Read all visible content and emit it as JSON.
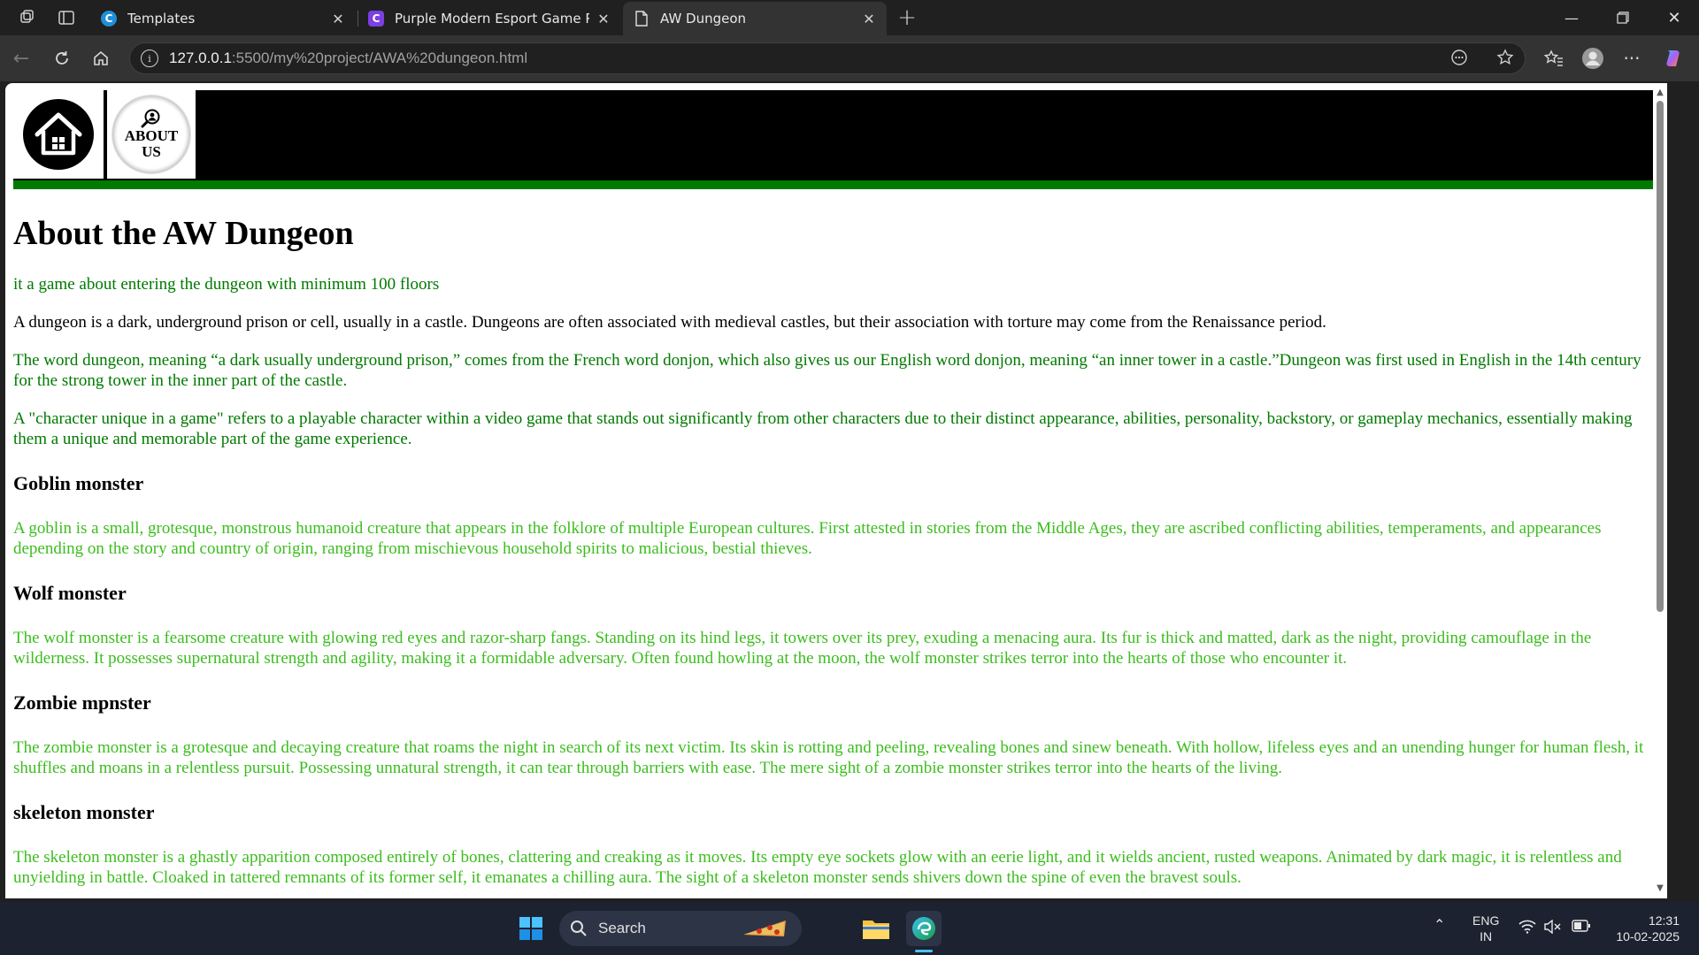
{
  "browser": {
    "tabs": [
      {
        "title": "Templates",
        "icon": "canva-icon",
        "active": false
      },
      {
        "title": "Purple Modern Esport Game Pres",
        "icon": "canva-doc-icon",
        "active": false
      },
      {
        "title": "AW Dungeon",
        "icon": "page-icon",
        "active": true
      }
    ],
    "url_host": "127.0.0.1",
    "url_path": ":5500/my%20project/AWA%20dungeon.html"
  },
  "nav": {
    "about_label_line1": "ABOUT",
    "about_label_line2": "US"
  },
  "content": {
    "title": "About the AW Dungeon",
    "intro": "it a game about entering the dungeon with minimum 100 floors",
    "para1": "A dungeon is a dark, underground prison or cell, usually in a castle. Dungeons are often associated with medieval castles, but their association with torture may come from the Renaissance period.",
    "para2": "The word dungeon, meaning “a dark usually underground prison,” comes from the French word donjon, which also gives us our English word donjon, meaning “an inner tower in a castle.”Dungeon was first used in English in the 14th century for the strong tower in the inner part of the castle.",
    "para3": "A \"character unique in a game\" refers to a playable character within a video game that stands out significantly from other characters due to their distinct appearance, abilities, personality, backstory, or gameplay mechanics, essentially making them a unique and memorable part of the game experience.",
    "sections": [
      {
        "heading": "Goblin monster",
        "text": "A goblin is a small, grotesque, monstrous humanoid creature that appears in the folklore of multiple European cultures. First attested in stories from the Middle Ages, they are ascribed conflicting abilities, temperaments, and appearances depending on the story and country of origin, ranging from mischievous household spirits to malicious, bestial thieves."
      },
      {
        "heading": "Wolf monster",
        "text": "The wolf monster is a fearsome creature with glowing red eyes and razor-sharp fangs. Standing on its hind legs, it towers over its prey, exuding a menacing aura. Its fur is thick and matted, dark as the night, providing camouflage in the wilderness. It possesses supernatural strength and agility, making it a formidable adversary. Often found howling at the moon, the wolf monster strikes terror into the hearts of those who encounter it."
      },
      {
        "heading": "Zombie mpnster",
        "text": "The zombie monster is a grotesque and decaying creature that roams the night in search of its next victim. Its skin is rotting and peeling, revealing bones and sinew beneath. With hollow, lifeless eyes and an unending hunger for human flesh, it shuffles and moans in a relentless pursuit. Possessing unnatural strength, it can tear through barriers with ease. The mere sight of a zombie monster strikes terror into the hearts of the living."
      },
      {
        "heading": "skeleton monster",
        "text": "The skeleton monster is a ghastly apparition composed entirely of bones, clattering and creaking as it moves. Its empty eye sockets glow with an eerie light, and it wields ancient, rusted weapons. Animated by dark magic, it is relentless and unyielding in battle. Cloaked in tattered remnants of its former self, it emanates a chilling aura. The sight of a skeleton monster sends shivers down the spine of even the bravest souls."
      }
    ]
  },
  "taskbar": {
    "search_label": "Search",
    "lang_line1": "ENG",
    "lang_line2": "IN",
    "time": "12:31",
    "date": "10-02-2025"
  },
  "colors": {
    "nav_bar": "#000000",
    "nav_underline": "#007a00",
    "text_green": "#007a00",
    "text_lightgreen": "#3cbd1e"
  }
}
